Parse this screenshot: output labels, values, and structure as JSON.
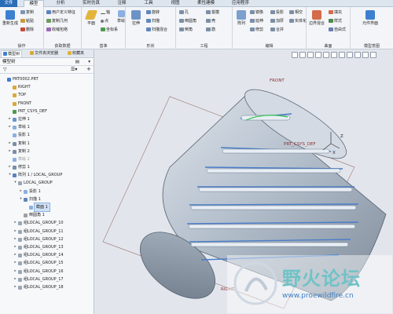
{
  "menu": {
    "tabs": [
      "文件",
      "模型",
      "分析",
      "实时仿真",
      "注释",
      "工具",
      "视图",
      "柔性建模",
      "应用程序"
    ],
    "active": "模型"
  },
  "ribbon": {
    "groups": [
      {
        "label": "操作",
        "items": [
          "重新生成",
          "复制",
          "粘贴",
          "删除"
        ]
      },
      {
        "label": "获取数据",
        "items": [
          "用户定义特征",
          "复制几何",
          "收缩包络"
        ]
      },
      {
        "label": "基准",
        "items": [
          "平面",
          "轴",
          "点",
          "坐标系",
          "草绘"
        ]
      },
      {
        "label": "形状",
        "items": [
          "拉伸",
          "旋转",
          "扫描",
          "扫描混合"
        ]
      },
      {
        "label": "工程",
        "items": [
          "孔",
          "倒圆角",
          "倒角",
          "拔模",
          "壳",
          "筋"
        ]
      },
      {
        "label": "编辑",
        "items": [
          "阵列",
          "镜像",
          "延伸",
          "修剪",
          "投影",
          "加厚",
          "合并",
          "相交",
          "实体化"
        ]
      },
      {
        "label": "曲面",
        "items": [
          "边界混合",
          "填充",
          "样式",
          "自由式"
        ]
      },
      {
        "label": "模型意图",
        "items": [
          "元件界面"
        ]
      }
    ]
  },
  "panel": {
    "tabs": [
      "模型树",
      "文件夹浏览器",
      "收藏夹"
    ],
    "header": "模型树",
    "tree": [
      {
        "label": "PRT0002.PRT",
        "level": 0,
        "expander": "",
        "type": "part"
      },
      {
        "label": "RIGHT",
        "level": 1,
        "expander": "",
        "type": "plane"
      },
      {
        "label": "TOP",
        "level": 1,
        "expander": "",
        "type": "plane"
      },
      {
        "label": "FRONT",
        "level": 1,
        "expander": "",
        "type": "plane"
      },
      {
        "label": "PRT_CSYS_DEF",
        "level": 1,
        "expander": "",
        "type": "csys"
      },
      {
        "label": "拉伸 1",
        "level": 1,
        "expander": "▸",
        "type": "extrude"
      },
      {
        "label": "草绘 1",
        "level": 1,
        "expander": "▸",
        "type": "sketch"
      },
      {
        "label": "投影 1",
        "level": 1,
        "expander": "",
        "type": "sketch"
      },
      {
        "label": "复制 1",
        "level": 1,
        "expander": "▸",
        "type": "feature"
      },
      {
        "label": "复制 2",
        "level": 1,
        "expander": "▸",
        "type": "feature"
      },
      {
        "label": "草绘 2",
        "level": 1,
        "expander": "",
        "type": "sketch",
        "dim": true
      },
      {
        "label": "修剪 1",
        "level": 1,
        "expander": "▸",
        "type": "feature"
      },
      {
        "label": "阵列 1 / LOCAL_GROUP",
        "level": 1,
        "expander": "▾",
        "type": "pattern"
      },
      {
        "label": "LOCAL_GROUP",
        "level": 2,
        "expander": "▾",
        "type": "group"
      },
      {
        "label": "投影 1",
        "level": 3,
        "expander": "▸",
        "type": "sketch"
      },
      {
        "label": "扫描 1",
        "level": 3,
        "expander": "▾",
        "type": "sweep"
      },
      {
        "label": "截面 1",
        "level": 4,
        "expander": "",
        "type": "sketch",
        "selected": true
      },
      {
        "label": "倒圆角 1",
        "level": 3,
        "expander": "",
        "type": "round"
      },
      {
        "label": "组LOCAL_GROUP_10",
        "level": 2,
        "expander": "▸",
        "type": "group"
      },
      {
        "label": "组LOCAL_GROUP_11",
        "level": 2,
        "expander": "▸",
        "type": "group"
      },
      {
        "label": "组LOCAL_GROUP_12",
        "level": 2,
        "expander": "▸",
        "type": "group"
      },
      {
        "label": "组LOCAL_GROUP_13",
        "level": 2,
        "expander": "▸",
        "type": "group"
      },
      {
        "label": "组LOCAL_GROUP_14",
        "level": 2,
        "expander": "▸",
        "type": "group"
      },
      {
        "label": "组LOCAL_GROUP_15",
        "level": 2,
        "expander": "▸",
        "type": "group"
      },
      {
        "label": "组LOCAL_GROUP_16",
        "level": 2,
        "expander": "▸",
        "type": "group"
      },
      {
        "label": "组LOCAL_GROUP_17",
        "level": 2,
        "expander": "▸",
        "type": "group"
      },
      {
        "label": "组LOCAL_GROUP_18",
        "level": 2,
        "expander": "▸",
        "type": "group"
      }
    ]
  },
  "viewport": {
    "datum_labels": {
      "front": "FRONT",
      "csys": "PRT_CSYS_DEF",
      "right": "RIGHT",
      "x": "X",
      "z": "Z"
    }
  },
  "watermark": {
    "name": "野火论坛",
    "url": "www.proewildfire.cn"
  },
  "colors": {
    "accent": "#2b6cb7",
    "model": "#b7c3d1",
    "model_dark": "#7b8898",
    "groove": "#4a7dc9"
  }
}
